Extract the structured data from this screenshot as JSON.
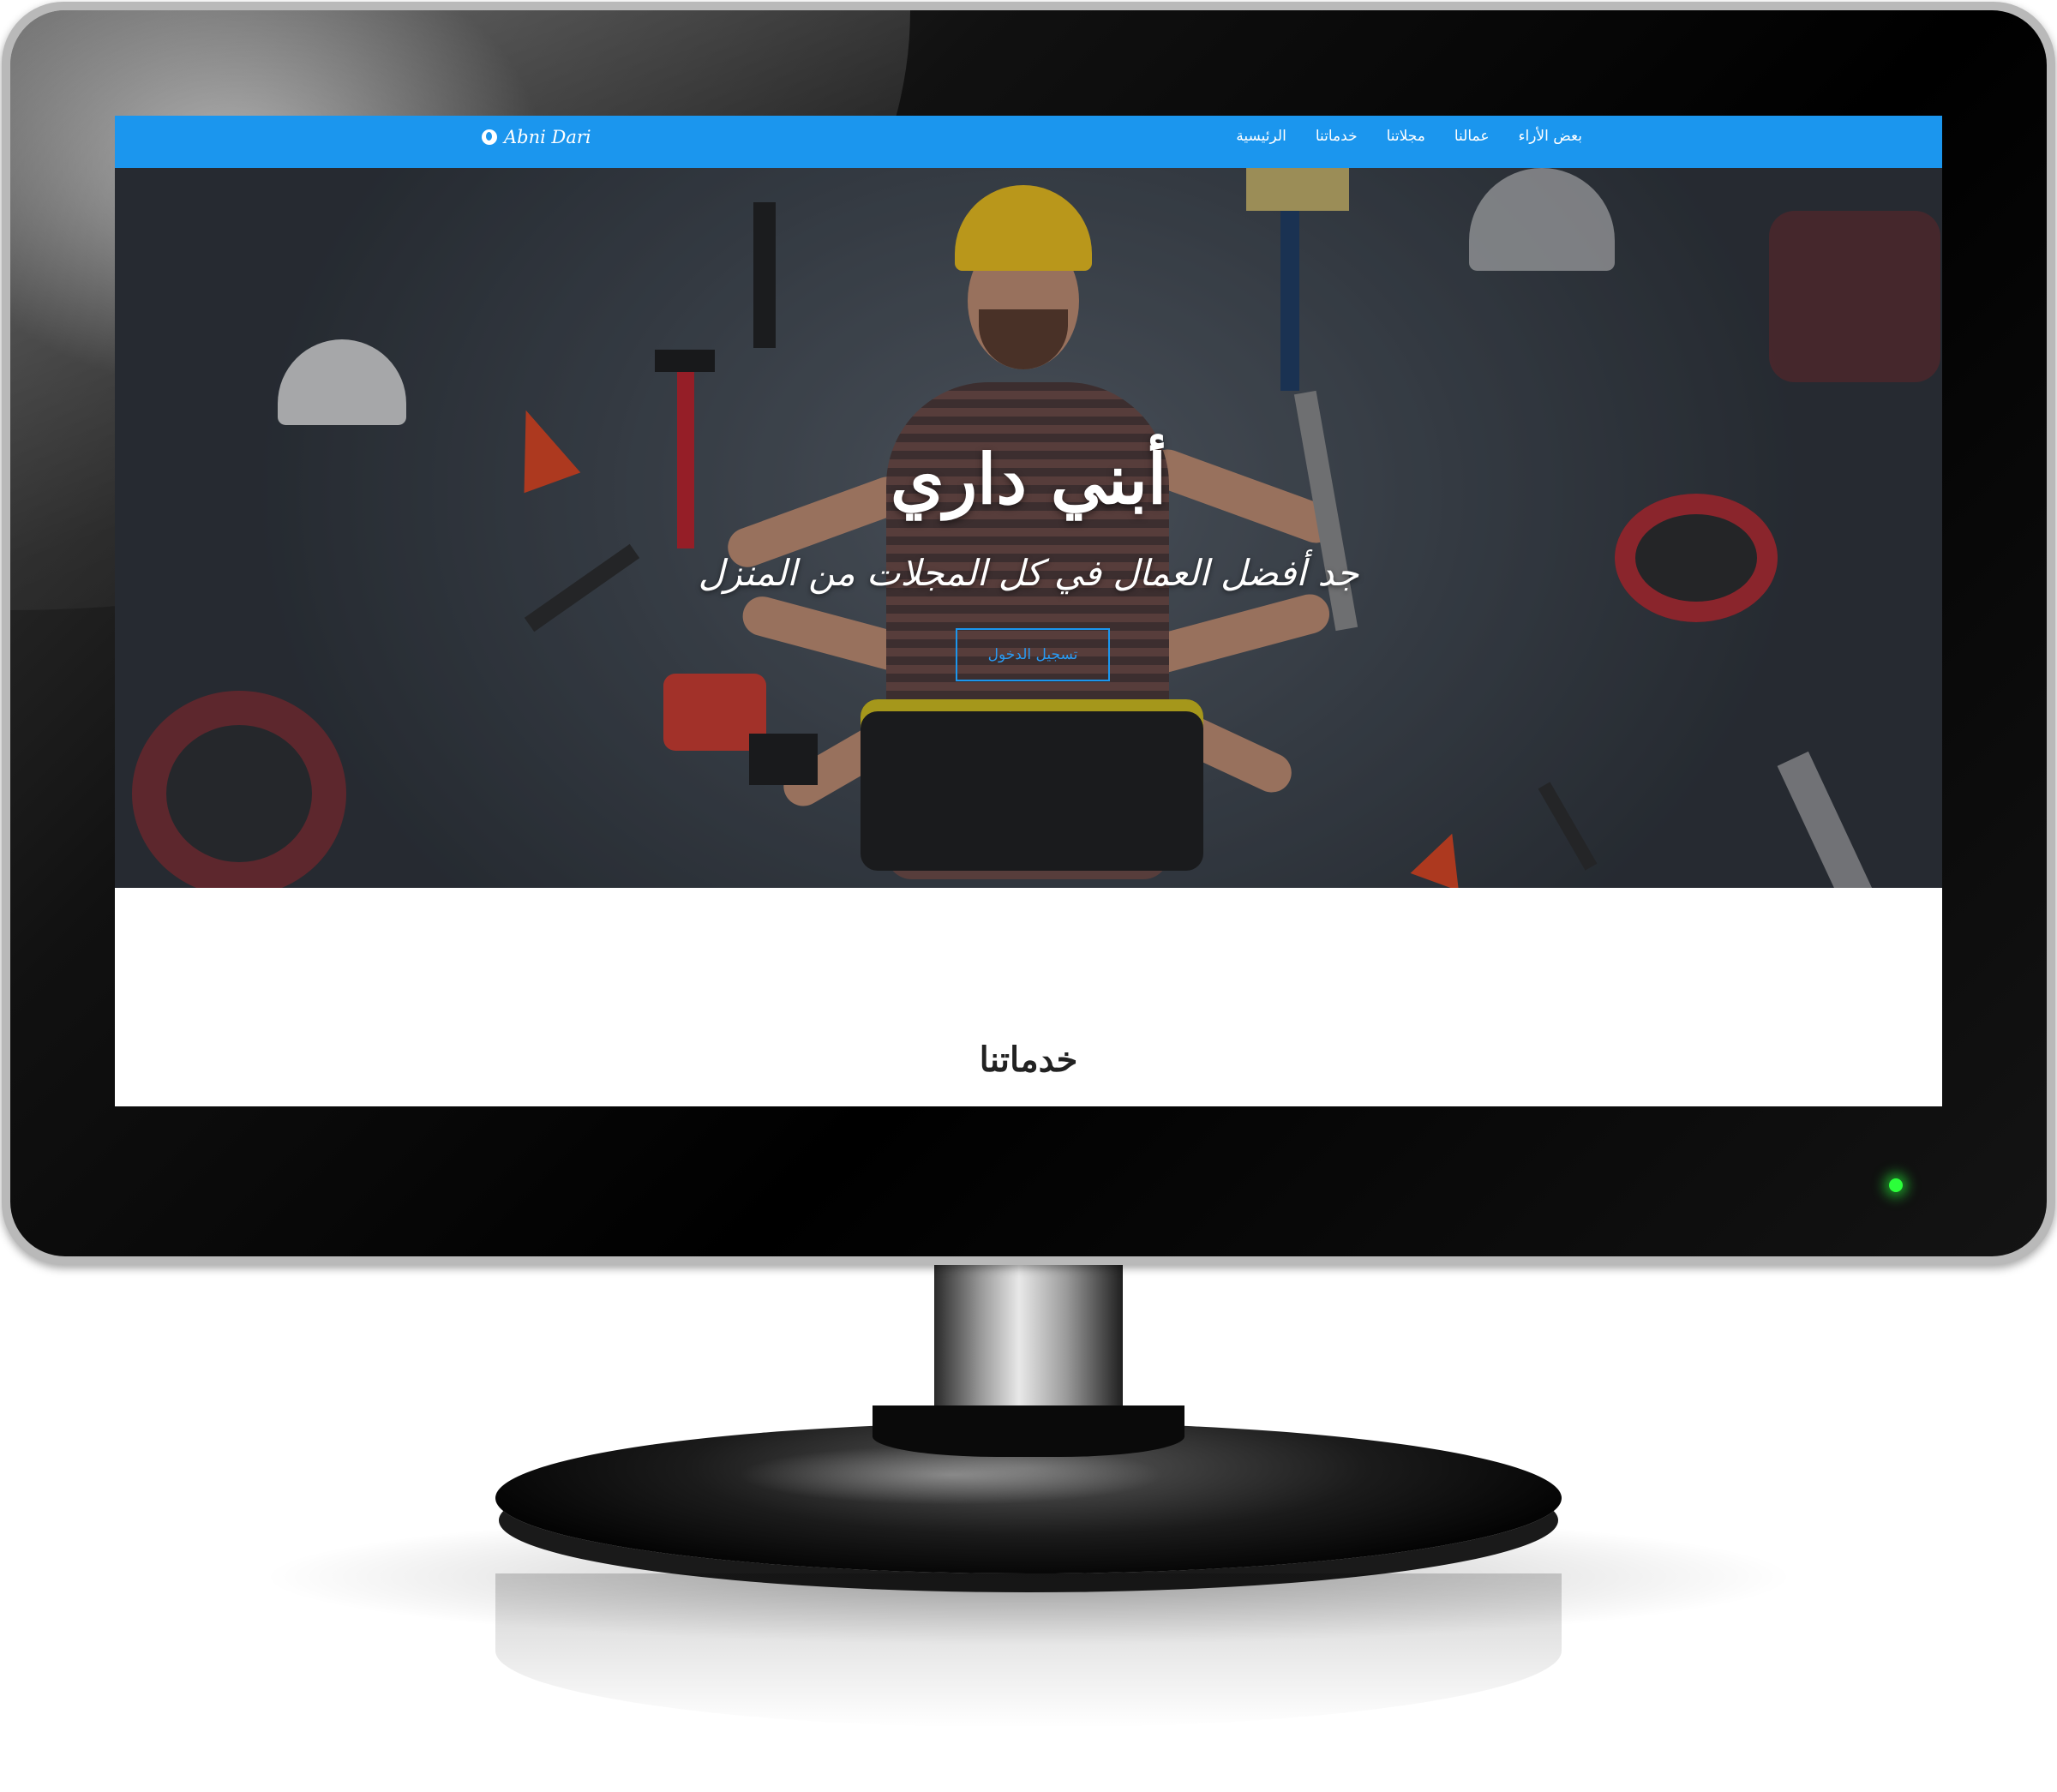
{
  "navbar": {
    "brand": "Abni Dari",
    "brand_icon": "globe-icon",
    "background": "#1b96ee",
    "links": [
      "الرئيسية",
      "خدماتنا",
      "مجلاتنا",
      "عمالنا",
      "بعض الأراء"
    ]
  },
  "hero": {
    "title": "أبني داري",
    "subtitle": "جد أفضل العمال في كل المجلات من المنزل",
    "button_label": "تسجيل الدخول"
  },
  "services": {
    "title": "خدماتنا"
  },
  "colors": {
    "accent": "#1b96ee",
    "power_led": "#2bff3a"
  }
}
